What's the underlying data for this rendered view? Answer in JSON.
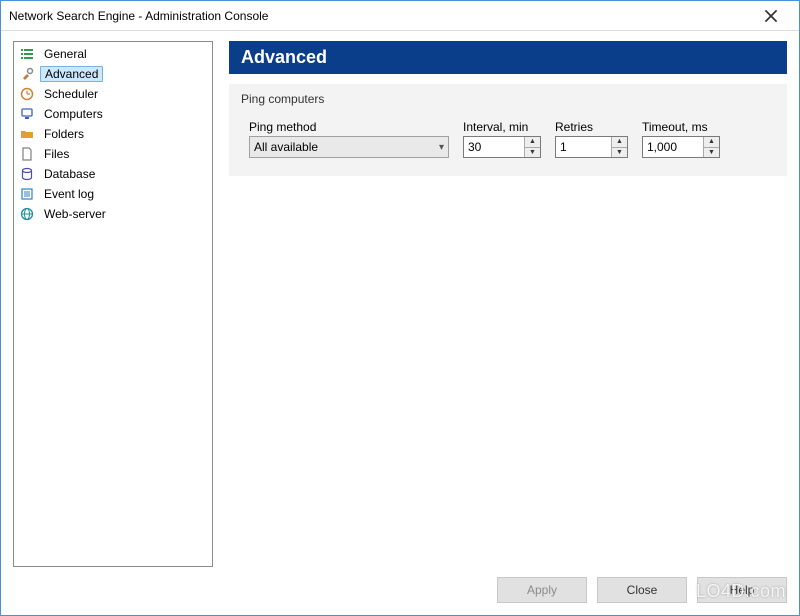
{
  "window": {
    "title": "Network Search Engine - Administration Console"
  },
  "sidebar": {
    "items": [
      {
        "label": "General",
        "icon": "list-icon",
        "color": "#2e9c4b"
      },
      {
        "label": "Advanced",
        "icon": "tools-icon",
        "color": "#c08040",
        "selected": true
      },
      {
        "label": "Scheduler",
        "icon": "clock-icon",
        "color": "#d08030"
      },
      {
        "label": "Computers",
        "icon": "computer-icon",
        "color": "#4060c0"
      },
      {
        "label": "Folders",
        "icon": "folder-icon",
        "color": "#e0a030"
      },
      {
        "label": "Files",
        "icon": "file-icon",
        "color": "#808080"
      },
      {
        "label": "Database",
        "icon": "database-icon",
        "color": "#5050a0"
      },
      {
        "label": "Event log",
        "icon": "log-icon",
        "color": "#3080c0"
      },
      {
        "label": "Web-server",
        "icon": "globe-icon",
        "color": "#2090a0"
      }
    ]
  },
  "page": {
    "title": "Advanced",
    "group_title": "Ping computers",
    "ping_method": {
      "label": "Ping method",
      "value": "All available"
    },
    "interval": {
      "label": "Interval, min",
      "value": "30"
    },
    "retries": {
      "label": "Retries",
      "value": "1"
    },
    "timeout": {
      "label": "Timeout, ms",
      "value": "1,000"
    }
  },
  "footer": {
    "apply": "Apply",
    "close": "Close",
    "help": "Help"
  },
  "watermark": "LO4D.com"
}
